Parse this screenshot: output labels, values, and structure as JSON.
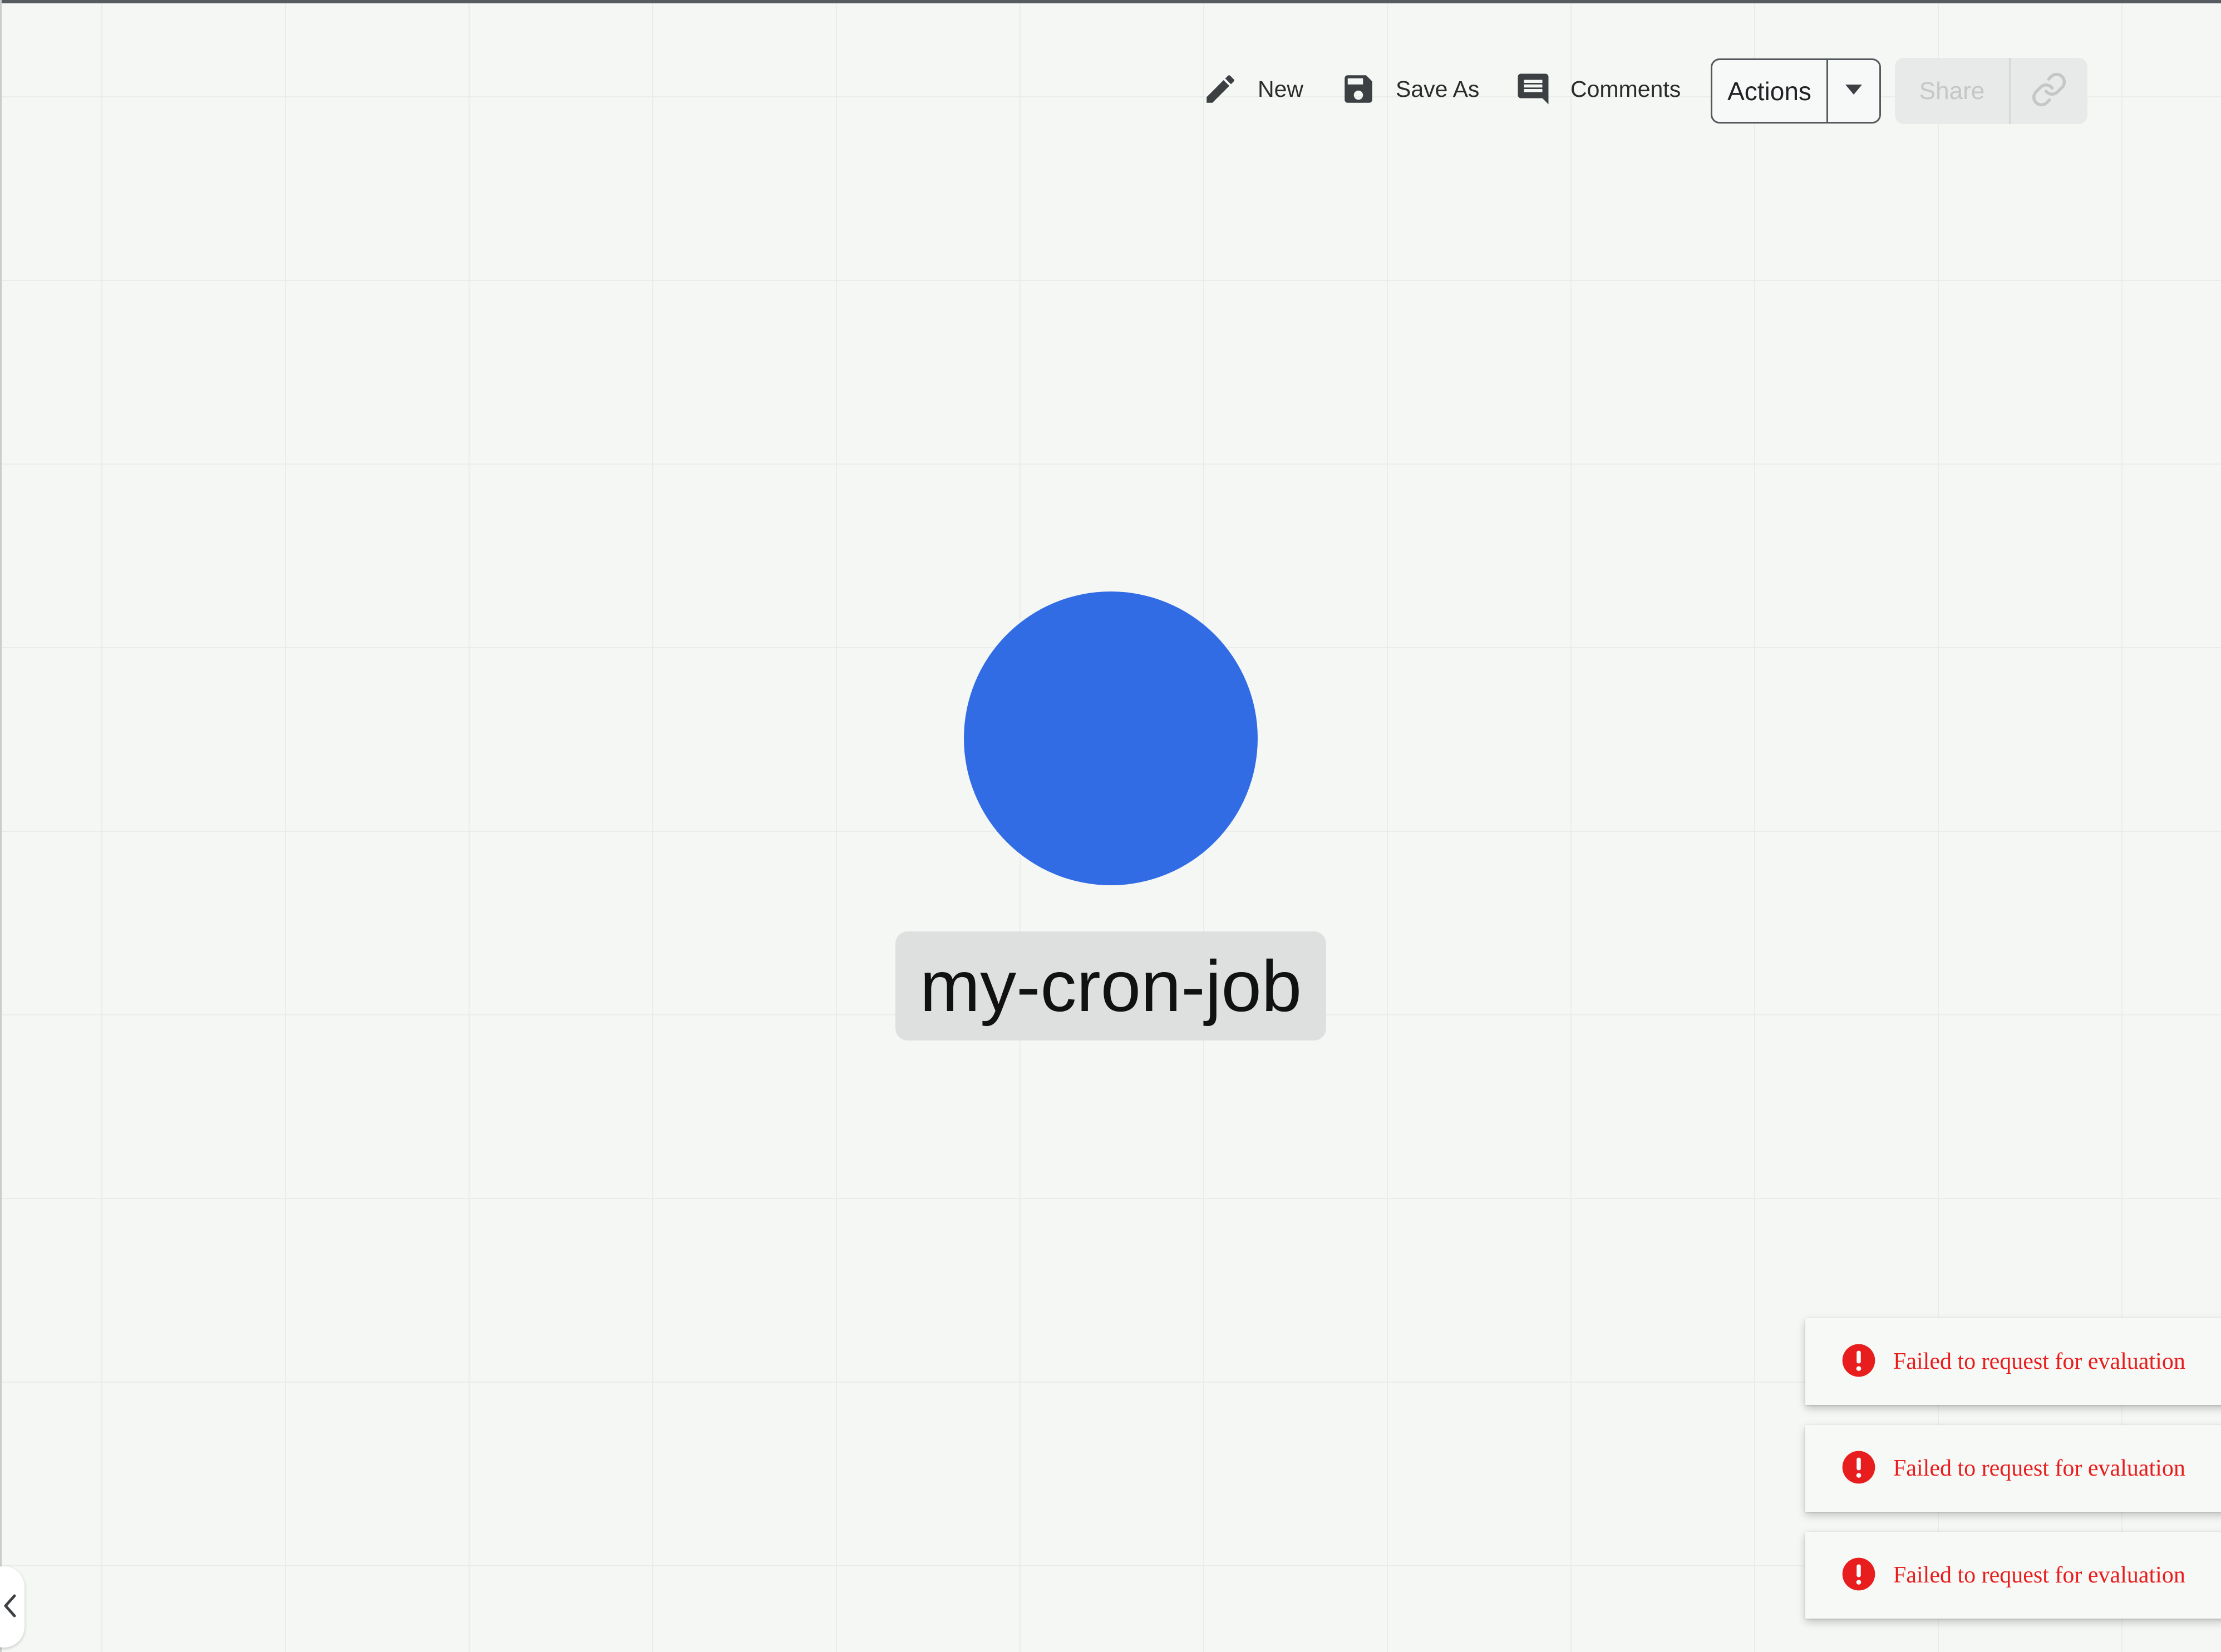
{
  "toolbar": {
    "new_label": "New",
    "save_as_label": "Save As",
    "comments_label": "Comments",
    "actions_label": "Actions",
    "share_label": "Share"
  },
  "canvas": {
    "node": {
      "name": "my-cron-job",
      "color": "#326ce5"
    }
  },
  "notifications": [
    {
      "type": "error",
      "message": "Failed to request for evaluation"
    },
    {
      "type": "error",
      "message": "Failed to request for evaluation"
    },
    {
      "type": "error",
      "message": "Failed to request for evaluation"
    }
  ],
  "colors": {
    "canvas_background": "#f5f7f5",
    "error": "#e81e1e",
    "node": "#326ce5"
  },
  "icons": {
    "new": "pencil-icon",
    "save_as": "floppy-disk-icon",
    "comments": "comment-icon",
    "actions_dropdown": "caret-down-icon",
    "share_link": "link-icon",
    "error": "error-circle-icon",
    "collapse": "chevron-left-icon"
  }
}
